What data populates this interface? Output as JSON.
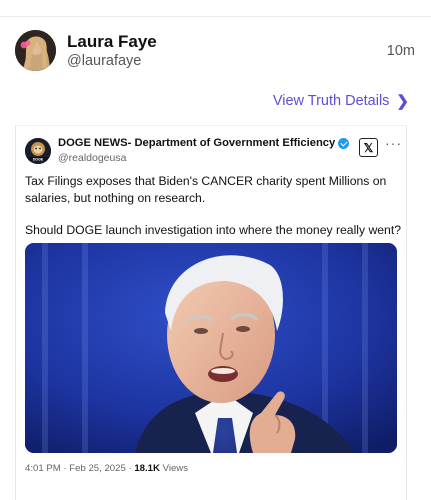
{
  "post": {
    "author_name": "Laura Faye",
    "author_handle": "@laurafaye",
    "timestamp": "10m",
    "view_details_label": "View Truth Details",
    "view_details_icon": "chevron-right-icon"
  },
  "embedded_tweet": {
    "account_name": "DOGE NEWS- Department of Government Efficiency",
    "account_handle": "@realdogeusa",
    "verified": true,
    "platform_icon": "x-logo-icon",
    "more_icon": "more-dots-icon",
    "paragraphs": [
      "Tax Filings exposes that Biden's CANCER charity spent Millions on salaries, but nothing on research.",
      "Should DOGE launch investigation into where the money really went?"
    ],
    "posted_time": "4:01 PM · Feb 25, 2025 · ",
    "views_count": "18.1K",
    "views_label": " Views"
  },
  "colors": {
    "link": "#5b4fd6",
    "verified": "#1d9bf0",
    "photo_background": "#1c2f8a"
  }
}
